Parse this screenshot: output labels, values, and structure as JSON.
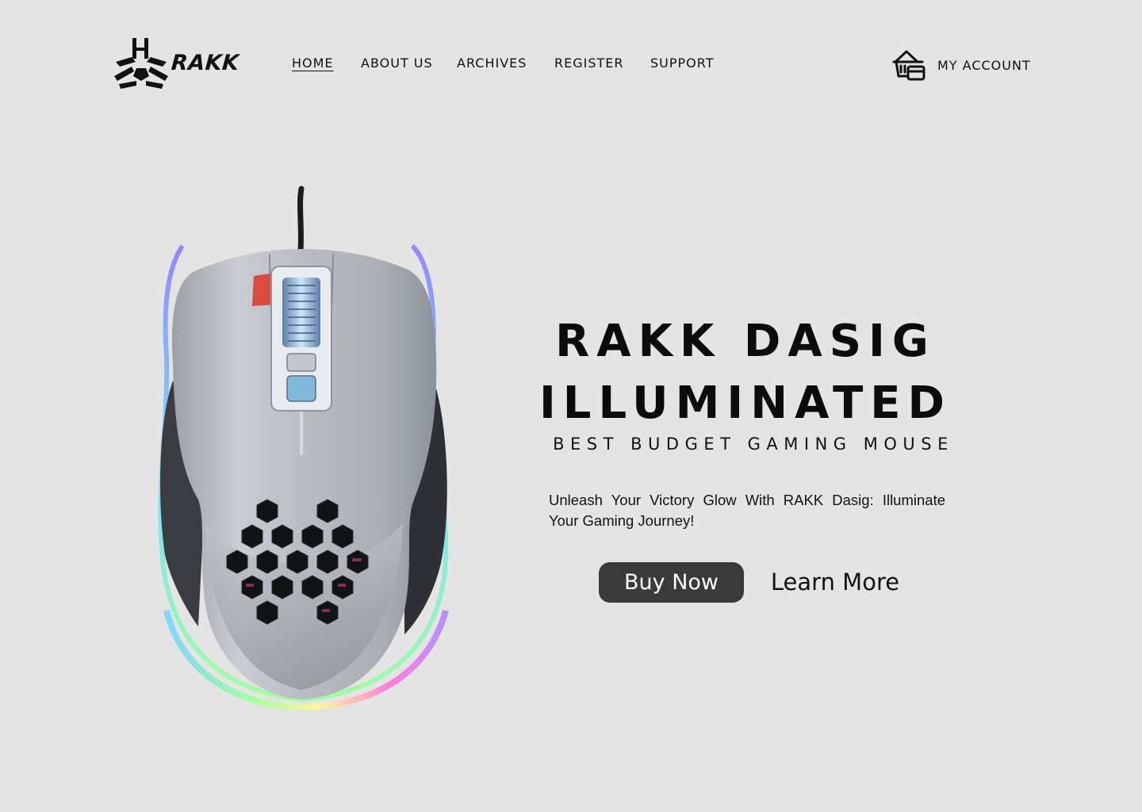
{
  "brand": {
    "name": "RAKK",
    "logo_icon": "rakk-tri-h-logo-icon"
  },
  "nav": {
    "items": [
      {
        "label": "HOME",
        "active": true
      },
      {
        "label": "ABOUT US",
        "active": false
      },
      {
        "label": "ARCHIVES",
        "active": false
      },
      {
        "label": "REGISTER",
        "active": false
      },
      {
        "label": "SUPPORT",
        "active": false
      }
    ]
  },
  "account": {
    "icon": "shopping-basket-card-icon",
    "label": "MY ACCOUNT"
  },
  "hero": {
    "title_line1": "RAKK DASIG",
    "title_line2": "ILLUMINATED",
    "subtitle": "BEST BUDGET GAMING MOUSE",
    "description": "Unleash Your Victory Glow With RAKK Dasig: Illuminate Your Gaming Journey!",
    "buy_label": "Buy Now",
    "learn_label": "Learn More",
    "product_image": "gaming-mouse-image"
  },
  "colors": {
    "background": "#e4e4e4",
    "text": "#111111",
    "buy_button": "#3a3a3a",
    "buy_text": "#ffffff"
  }
}
